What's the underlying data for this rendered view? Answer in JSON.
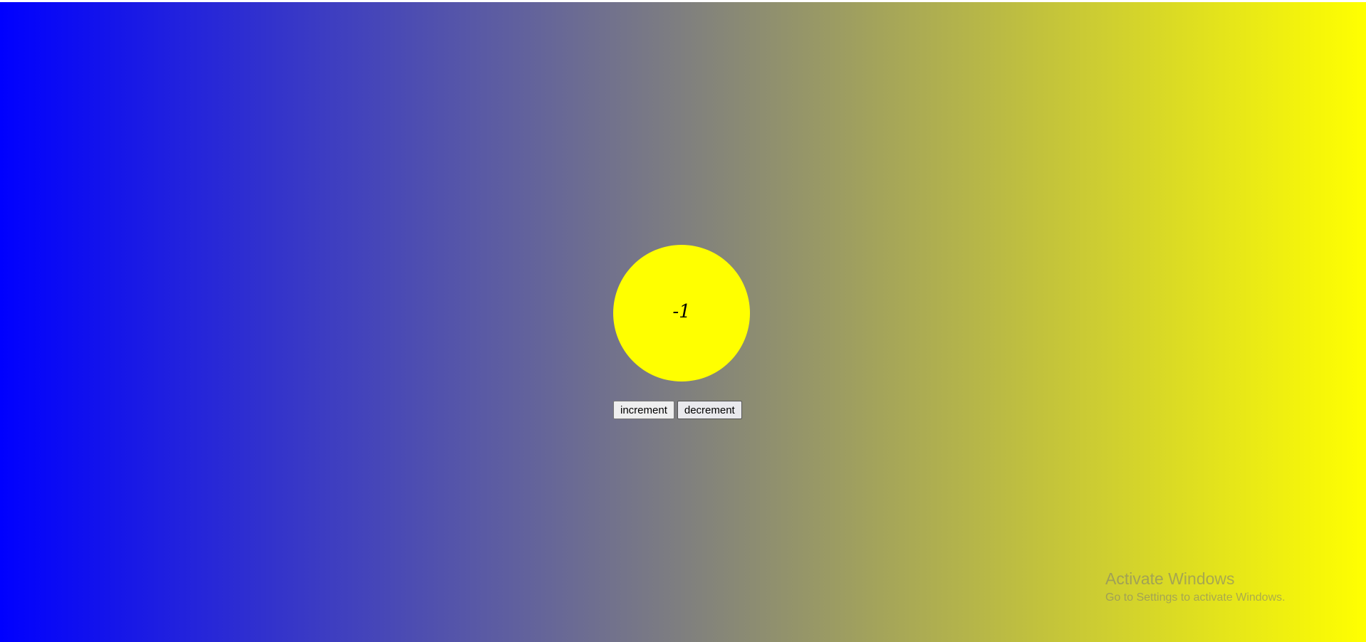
{
  "counter": {
    "value": "-1",
    "circle_color": "#ffff00"
  },
  "controls": {
    "increment_label": "increment",
    "decrement_label": "decrement"
  },
  "background": {
    "gradient_start": "#0000ff",
    "gradient_end": "#ffff00"
  },
  "watermark": {
    "title": "Activate Windows",
    "subtitle": "Go to Settings to activate Windows."
  }
}
